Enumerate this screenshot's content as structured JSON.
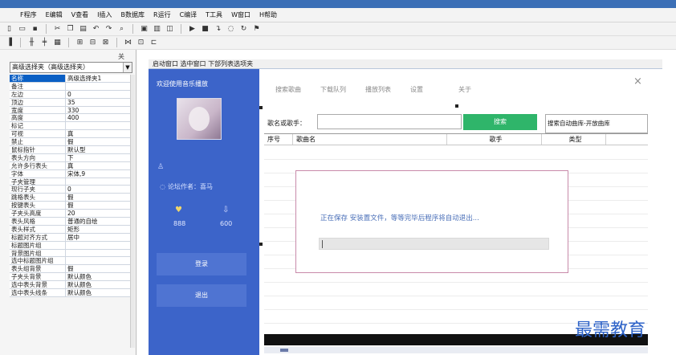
{
  "menubar": {
    "items": [
      "F程序",
      "E编辑",
      "V查看",
      "I插入",
      "B数据库",
      "R运行",
      "C编译",
      "T工具",
      "W窗口",
      "H帮助"
    ]
  },
  "toolbar1": {
    "icons": [
      "new-icon",
      "open-icon",
      "save-icon",
      "cut-icon",
      "copy-icon",
      "paste-icon",
      "undo-icon",
      "redo-icon",
      "find-icon",
      "window-icon",
      "run-icon",
      "stop-icon",
      "step-icon",
      "breakpoint-icon",
      "compile-icon"
    ]
  },
  "toolbar2": {
    "icons": [
      "align-left-icon",
      "align-center-icon",
      "align-right-icon",
      "grid-icon",
      "table-icon",
      "layout-icon",
      "size-icon",
      "group-icon",
      "order-icon"
    ]
  },
  "properties": {
    "close": "关",
    "selector": "高级选择夹（高级选择夹）",
    "rows": [
      {
        "k": "名称",
        "v": "高级选择夹1"
      },
      {
        "k": "备注",
        "v": ""
      },
      {
        "k": "左边",
        "v": "0"
      },
      {
        "k": "顶边",
        "v": "35"
      },
      {
        "k": "宽度",
        "v": "330"
      },
      {
        "k": "高度",
        "v": "400"
      },
      {
        "k": "标记",
        "v": ""
      },
      {
        "k": "可视",
        "v": "真"
      },
      {
        "k": "禁止",
        "v": "假"
      },
      {
        "k": "鼠标指针",
        "v": "默认型"
      },
      {
        "k": "表头方向",
        "v": "下"
      },
      {
        "k": "允许多行表头",
        "v": "真"
      },
      {
        "k": "字体",
        "v": "宋体,9"
      },
      {
        "k": "子夹管理",
        "v": ""
      },
      {
        "k": "现行子夹",
        "v": "0"
      },
      {
        "k": "跳格表头",
        "v": "假"
      },
      {
        "k": "按键表头",
        "v": "假"
      },
      {
        "k": "子夹头高度",
        "v": "20"
      },
      {
        "k": "表头风格",
        "v": "普通的自绘"
      },
      {
        "k": "  表头样式",
        "v": "矩形"
      },
      {
        "k": "标题对齐方式",
        "v": "居中"
      },
      {
        "k": "标题图片组",
        "v": ""
      },
      {
        "k": "背景图片组",
        "v": ""
      },
      {
        "k": "选中标题图片组",
        "v": ""
      },
      {
        "k": "表头组背景",
        "v": "假"
      },
      {
        "k": "子夹头背景",
        "v": "默认颜色"
      },
      {
        "k": "选中表头背景",
        "v": "默认颜色"
      },
      {
        "k": "选中表头线条",
        "v": "默认颜色"
      }
    ]
  },
  "editor": {
    "tab_label": "启动窗口 选中窗口 下部列表选项夹"
  },
  "sidebar": {
    "title": "欢迎使用音乐播放",
    "author": "论坛作者：喜马",
    "stat1": "888",
    "stat2": "600",
    "button1": "登录",
    "button2": "退出"
  },
  "main": {
    "tabs": [
      "搜索歌曲",
      "下载队列",
      "播放列表",
      "设置",
      "关于"
    ],
    "close": "×",
    "search_label": "歌名或歌手：",
    "search_value": "",
    "search_button": "搜索",
    "library": "搜索自动曲库-开放曲库",
    "columns": [
      "序号",
      "歌曲名",
      "歌手",
      "类型"
    ],
    "dialog_text": "正在保存 安装置文件，等等完毕后程序将自动退出...",
    "dialog_progress": 0
  },
  "watermark": "最需教育",
  "colors": {
    "sidebar": "#3c64c9",
    "search_button": "#2fb56a",
    "selection": "#0a5fc4"
  }
}
